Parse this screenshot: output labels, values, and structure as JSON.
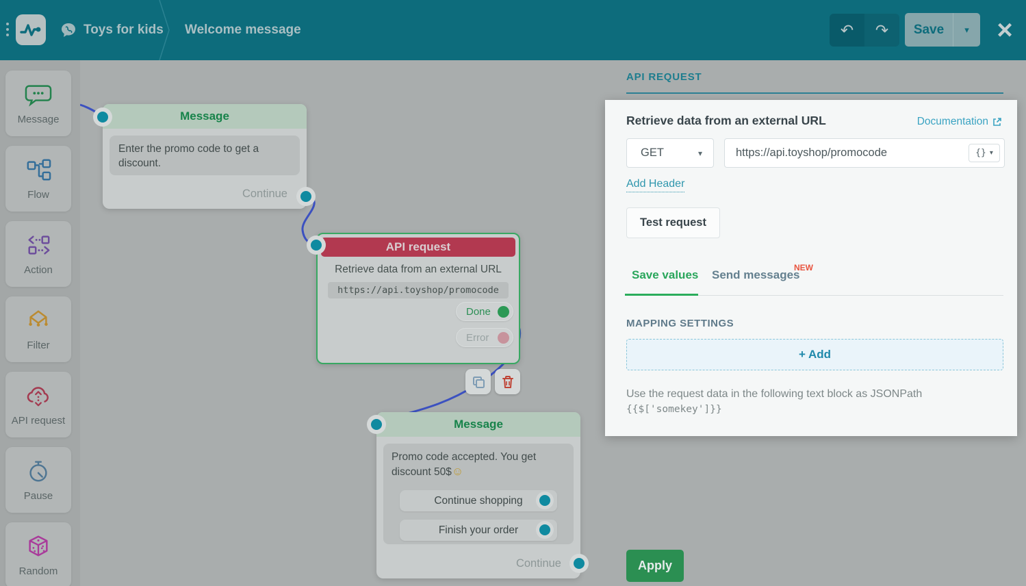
{
  "header": {
    "bot_name": "Toys for kids",
    "flow_name": "Welcome message",
    "undo_glyph": "↶",
    "redo_glyph": "↷",
    "save_label": "Save",
    "save_caret": "▾",
    "close_glyph": "×"
  },
  "sidebar": {
    "items": [
      {
        "label": "Message",
        "icon": "message-bubble-icon",
        "color": "#23824d"
      },
      {
        "label": "Flow",
        "icon": "flow-icon",
        "color": "#356f9a"
      },
      {
        "label": "Action",
        "icon": "action-icon",
        "color": "#6d4e9c"
      },
      {
        "label": "Filter",
        "icon": "filter-icon",
        "color": "#bb8b31"
      },
      {
        "label": "API request",
        "icon": "api-cloud-icon",
        "color": "#a33a50"
      },
      {
        "label": "Pause",
        "icon": "pause-clock-icon",
        "color": "#4f7693"
      },
      {
        "label": "Random",
        "icon": "random-dice-icon",
        "color": "#a93a9a"
      }
    ]
  },
  "canvas": {
    "message1": {
      "title": "Message",
      "text": "Enter the promo code to get a discount.",
      "continue_label": "Continue"
    },
    "api_node": {
      "title": "API request",
      "subtitle": "Retrieve data from an external URL",
      "url": "https://api.toyshop/promocode",
      "done_label": "Done",
      "error_label": "Error"
    },
    "message2": {
      "title": "Message",
      "text": "Promo code accepted. You get discount 50$",
      "emoji": "☺",
      "buttons": [
        "Continue shopping",
        "Finish your order"
      ],
      "continue_label": "Continue"
    }
  },
  "panel": {
    "heading": "API REQUEST",
    "title": "Retrieve data from an external URL",
    "doc_link": "Documentation",
    "method": "GET",
    "method_caret": "▾",
    "url": "https://api.toyshop/promocode",
    "braces_glyph": "{}",
    "braces_caret": "▾",
    "add_header_link": "Add Header",
    "test_request_label": "Test request",
    "tabs": {
      "save_values": "Save values",
      "send_messages": "Send messages",
      "new_badge": "NEW"
    },
    "mapping_heading": "MAPPING SETTINGS",
    "add_button": "+ Add",
    "hint_text": "Use the request data in the following text block as JSONPath",
    "hint_code": "{{$['somekey']}}",
    "apply_label": "Apply"
  },
  "colors": {
    "header_teal": "#0d6c7c",
    "panel_accent_teal": "#2d8195",
    "link_teal": "#3aa3c2",
    "tab_active_green": "#29a65b",
    "new_badge_red": "#e8543f",
    "apply_green": "#2b8f52",
    "api_node_red": "#b23950",
    "node_title_green": "#17834a",
    "selected_border_green": "#38a862",
    "connector_teal": "#0f8aa0",
    "connection_blue": "#3c51c0",
    "canvas_dim_gray": "#a9adad"
  }
}
